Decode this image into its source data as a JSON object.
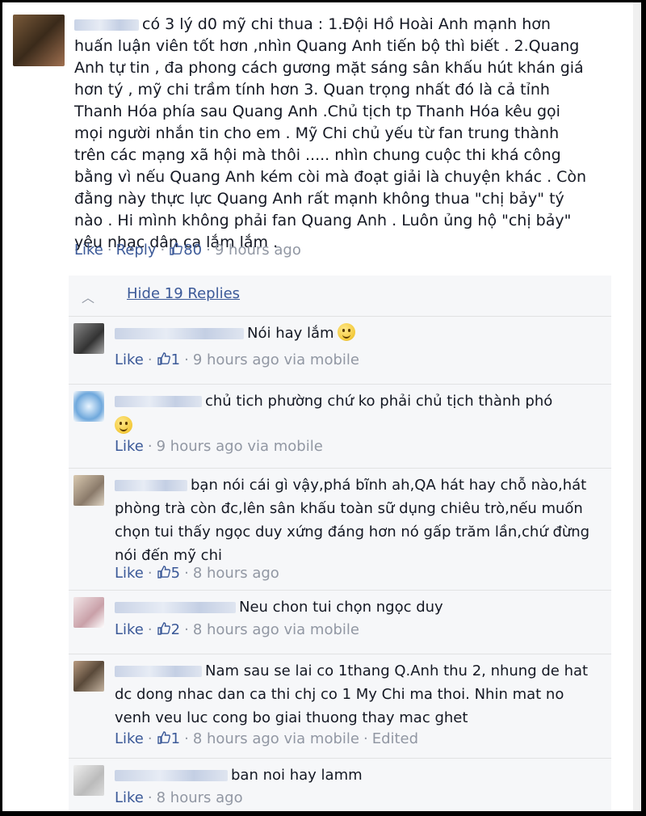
{
  "main_comment": {
    "text": "có 3 lý d0 mỹ chi thua : 1.Đội Hồ Hoài Anh mạnh hơn huấn luận viên tốt hơn ,nhìn Quang Anh tiến bộ thì biết . 2.Quang Anh tự tin , đa phong cách gương mặt sáng sân khấu hút khán giá hơn tý , mỹ chi trầm tính hơn 3. Quan trọng nhất đó là cả tỉnh Thanh Hóa phía sau Quang Anh .Chủ tịch tp Thanh Hóa kêu gọi mọi người nhắn tin cho em . Mỹ Chi chủ yếu từ fan trung thành trên các mạng xã hội mà thôi ..... nhìn chung cuộc thi khá công bằng vì nếu Quang Anh kém còi mà đoạt giải là chuyện khác . Còn đằng này thực lực Quang Anh rất mạnh không thua \"chị bảy\" tý nào . Hi mình không phải fan Quang Anh . Luôn ủng hộ \"chị bảy\" yêu nhạc dân ca lắm lắm .",
    "like_label": "Like",
    "reply_label": "Reply",
    "likes": "80",
    "time": "9 hours ago"
  },
  "hide_replies_label": "Hide 19 Replies",
  "replies": [
    {
      "text": "Nói hay lắm",
      "emoji": "smile-emoji",
      "like_label": "Like",
      "likes": "1",
      "time": "9 hours ago via mobile"
    },
    {
      "text": "chủ tich phường chứ ko phải chủ tịch thành phó",
      "emoji": "blush-emoji",
      "like_label": "Like",
      "likes": "",
      "time": "9 hours ago via mobile"
    },
    {
      "text": "bạn nói cái gì vậy,phá bĩnh ah,QA hát hay chỗ nào,hát phòng trà còn đc,lên sân khấu toàn sữ dụng chiêu trò,nếu muốn chọn tui thấy ngọc duy xứng đáng hơn nó gấp trăm lần,chứ đừng nói đến mỹ chi",
      "like_label": "Like",
      "likes": "5",
      "time": "8 hours ago"
    },
    {
      "text": "Neu chon tui chọn ngọc duy",
      "like_label": "Like",
      "likes": "2",
      "time": "8 hours ago via mobile"
    },
    {
      "text": "Nam sau se lai co 1thang Q.Anh thu 2, nhung de hat dc dong nhac dan ca thi chj co 1 My Chi ma thoi. Nhin mat no venh veu luc cong bo giai thuong thay mac ghet",
      "like_label": "Like",
      "likes": "1",
      "time": "8 hours ago via mobile",
      "edited": "Edited"
    },
    {
      "text": "ban noi hay lamm",
      "like_label": "Like",
      "likes": "",
      "time": "8 hours ago"
    }
  ]
}
